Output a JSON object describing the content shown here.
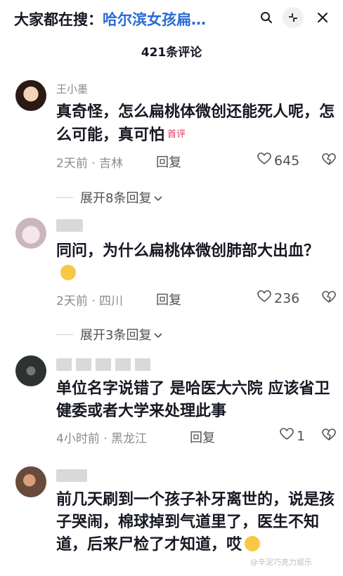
{
  "header": {
    "search_prefix": "大家都在搜：",
    "search_query": "哈尔滨女孩扁…",
    "search_icon": "search-icon",
    "collapse_icon": "collapse-icon",
    "close_icon": "close-icon"
  },
  "comment_count": "421条评论",
  "comments": [
    {
      "nickname": "王小墨",
      "text": "真奇怪，怎么扁桃体微创还能死人呢，怎么可能，真可怕",
      "tag": "首评",
      "time_location": "2天前 · 吉林",
      "reply_label": "回复",
      "likes": "645",
      "expand_label": "展开8条回复"
    },
    {
      "nickname": "",
      "text": "同问，为什么扁桃体微创肺部大出血？",
      "emoji": "crying-face-emoji",
      "time_location": "2天前 · 四川",
      "reply_label": "回复",
      "likes": "236",
      "expand_label": "展开3条回复"
    },
    {
      "nickname": "",
      "text": "单位名字说错了 是哈医大六院 应该省卫健委或者大学来处理此事",
      "time_location": "4小时前 · 黑龙江",
      "reply_label": "回复",
      "likes": "1"
    },
    {
      "nickname": "",
      "text": "前几天刷到一个孩子补牙离世的，说是孩子哭闹，棉球掉到气道里了，医生不知道，后来尸检了才知道，哎",
      "emoji": "sob-emoji"
    }
  ],
  "watermark": "@辛泥巧克力娱乐",
  "colors": {
    "link_blue": "#2a6bd6",
    "tag_red": "#e0365a",
    "meta_gray": "#8a8b91"
  }
}
